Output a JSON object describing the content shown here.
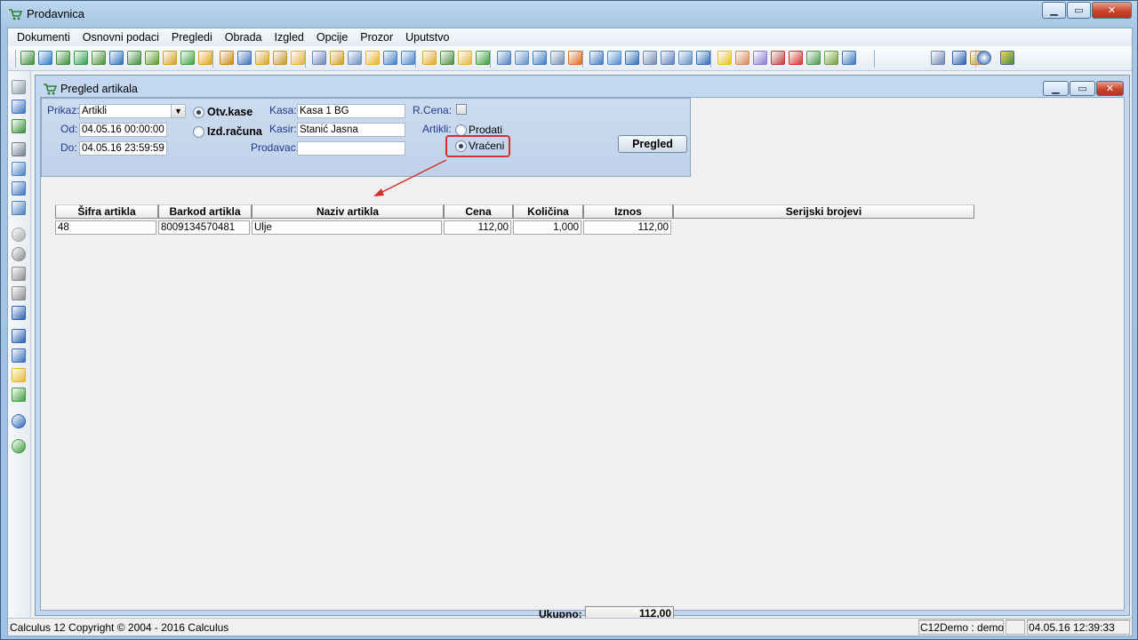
{
  "window": {
    "title": "Prodavnica"
  },
  "menu": [
    "Dokumenti",
    "Osnovni podaci",
    "Pregledi",
    "Obrada",
    "Izgled",
    "Opcije",
    "Prozor",
    "Uputstvo"
  ],
  "child": {
    "title": "Pregled artikala"
  },
  "filters": {
    "prikaz_label": "Prikaz:",
    "prikaz_value": "Artikli",
    "od_label": "Od:",
    "od_value": "04.05.16 00:00:00",
    "do_label": "Do:",
    "do_value": "04.05.16 23:59:59",
    "otv_kase": "Otv.kase",
    "izd_racuna": "Izd.računa",
    "kasa_label": "Kasa:",
    "kasa_value": "Kasa 1 BG",
    "kasir_label": "Kasir:",
    "kasir_value": "Stanić Jasna",
    "prodavac_label": "Prodavac:",
    "prodavac_value": "",
    "rcena_label": "R.Cena:",
    "artikli_label": "Artikli:",
    "prodati": "Prodati",
    "vraceni": "Vraćeni",
    "pregled_button": "Pregled"
  },
  "grid": {
    "columns": [
      "Šifra artikla",
      "Barkod artikla",
      "Naziv artikla",
      "Cena",
      "Količina",
      "Iznos",
      "Serijski brojevi"
    ],
    "rows": [
      {
        "sifra": "48",
        "barkod": "8009134570481",
        "naziv": "Ulje",
        "cena": "112,00",
        "kolicina": "1,000",
        "iznos": "112,00"
      }
    ],
    "total_label": "Ukupno:",
    "total_value": "112,00"
  },
  "status": {
    "copyright": "Calculus 12  Copyright © 2004 - 2016  Calculus",
    "user": "C12Demo : demo",
    "datetime": "04.05.16 12:39:33"
  },
  "colors": {
    "accent": "#d6302a",
    "panel": "#c3d8ee",
    "label": "#23388f"
  }
}
